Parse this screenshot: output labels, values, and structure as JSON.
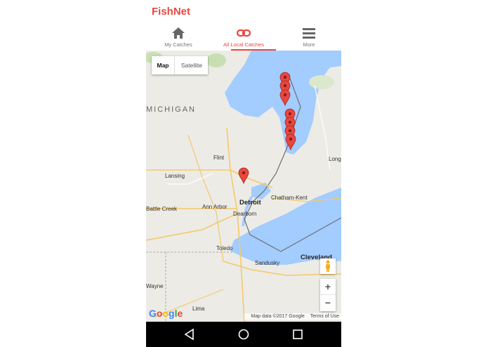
{
  "app": {
    "title": "FishNet"
  },
  "tabs": [
    {
      "label": "My Catches",
      "icon": "home-icon",
      "active": false
    },
    {
      "label": "All Local Catches",
      "icon": "link-icon",
      "active": true
    },
    {
      "label": "More",
      "icon": "menu-icon",
      "active": false
    }
  ],
  "map": {
    "type_control": {
      "map_label": "Map",
      "satellite_label": "Satellite",
      "selected": "Map"
    },
    "state_label": "MICHIGAN",
    "cities": [
      "Flint",
      "Lansing",
      "Battle Creek",
      "Ann Arbor",
      "Detroit",
      "Dearborn",
      "Chatham-Kent",
      "Toledo",
      "Sandusky",
      "Cleveland",
      "Wayne",
      "Lima",
      "Longu"
    ],
    "zoom_in_label": "+",
    "zoom_out_label": "−",
    "logo_text": "Google",
    "attribution": {
      "data": "Map data ©2017 Google",
      "terms": "Terms of Use"
    },
    "colors": {
      "water": "#a3ccff",
      "land": "#ecebe6",
      "marker": "#e8473f",
      "accent": "#e8473f"
    },
    "marker_count": 8
  },
  "navbar": {
    "icons": [
      "back-icon",
      "home-circle-icon",
      "recents-icon"
    ]
  }
}
